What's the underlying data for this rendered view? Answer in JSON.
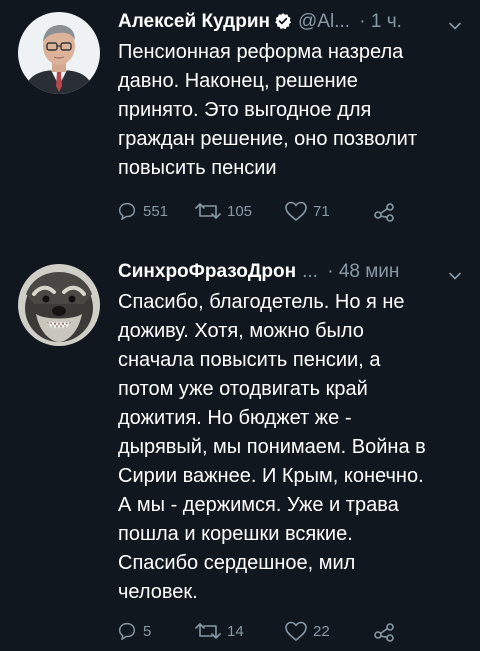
{
  "colors": {
    "background": "#10171e",
    "text": "#ffffff",
    "muted": "#8899a6",
    "verified": "#ffffff"
  },
  "tweets": [
    {
      "author_name": "Алексей Кудрин",
      "verified": true,
      "handle": "@Al...",
      "time": "· 1 ч.",
      "text": "Пенсионная реформа назрела\nдавно. Наконец, решение\nпринято. Это выгодное для\nграждан решение, оно позволит\nповысить пенсии",
      "replies": "551",
      "retweets": "105",
      "likes": "71",
      "icons": [
        "reply-icon",
        "retweet-icon",
        "like-icon",
        "share-icon"
      ]
    },
    {
      "author_name": "СинхроФразоДрон",
      "handle": "...",
      "time": "· 48 мин",
      "text": "Спасибо, благодетель. Но я не\nдоживу. Хотя, можно было\nсначала повысить пенсии, а\nпотом уже отодвигать край\nдожития. Но бюджет же -\nдырявый, мы понимаем. Война в\nСирии важнее. И Крым, конечно.\nА мы - держимся. Уже и трава\nпошла и корешки всякие.\nСпасибо сердешное, мил\nчеловек.",
      "replies": "5",
      "retweets": "14",
      "likes": "22",
      "icons": [
        "reply-icon",
        "retweet-icon",
        "like-icon",
        "share-icon"
      ]
    }
  ]
}
